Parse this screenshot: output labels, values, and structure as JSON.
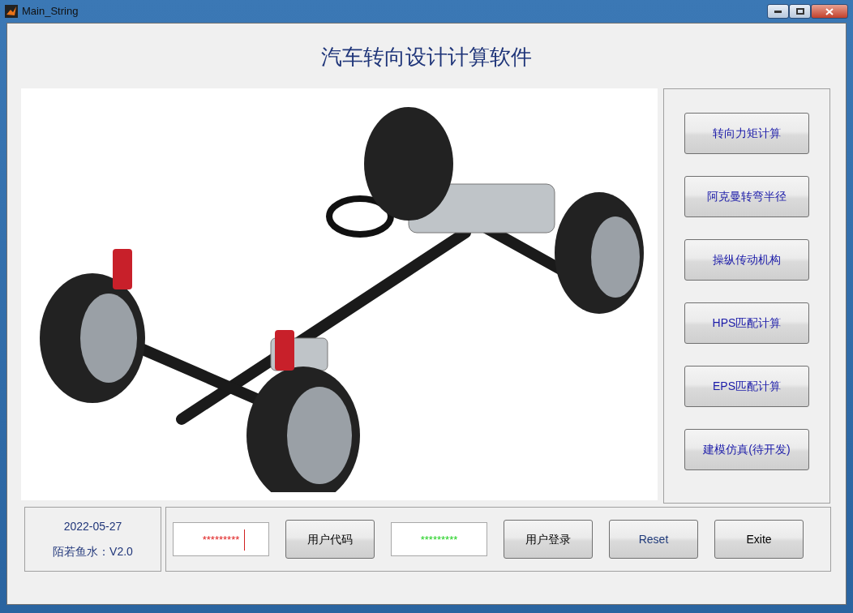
{
  "window": {
    "title": "Main_String"
  },
  "heading": "汽车转向设计计算软件",
  "side_buttons": [
    {
      "label": "转向力矩计算"
    },
    {
      "label": "阿克曼转弯半径"
    },
    {
      "label": "操纵传动机构"
    },
    {
      "label": "HPS匹配计算"
    },
    {
      "label": "EPS匹配计算"
    },
    {
      "label": "建模仿真(待开发)"
    }
  ],
  "info": {
    "date": "2022-05-27",
    "version": "陌若鱼水：V2.0"
  },
  "controls": [
    {
      "kind": "field",
      "value": "*********",
      "color": "#e02020",
      "focused": true
    },
    {
      "kind": "button",
      "label": "用户代码"
    },
    {
      "kind": "field",
      "value": "*********",
      "color": "#20d020",
      "focused": false
    },
    {
      "kind": "button",
      "label": "用户登录"
    },
    {
      "kind": "button",
      "label": "Reset",
      "color": "#1f3a7a"
    },
    {
      "kind": "button",
      "label": "Exite"
    }
  ]
}
